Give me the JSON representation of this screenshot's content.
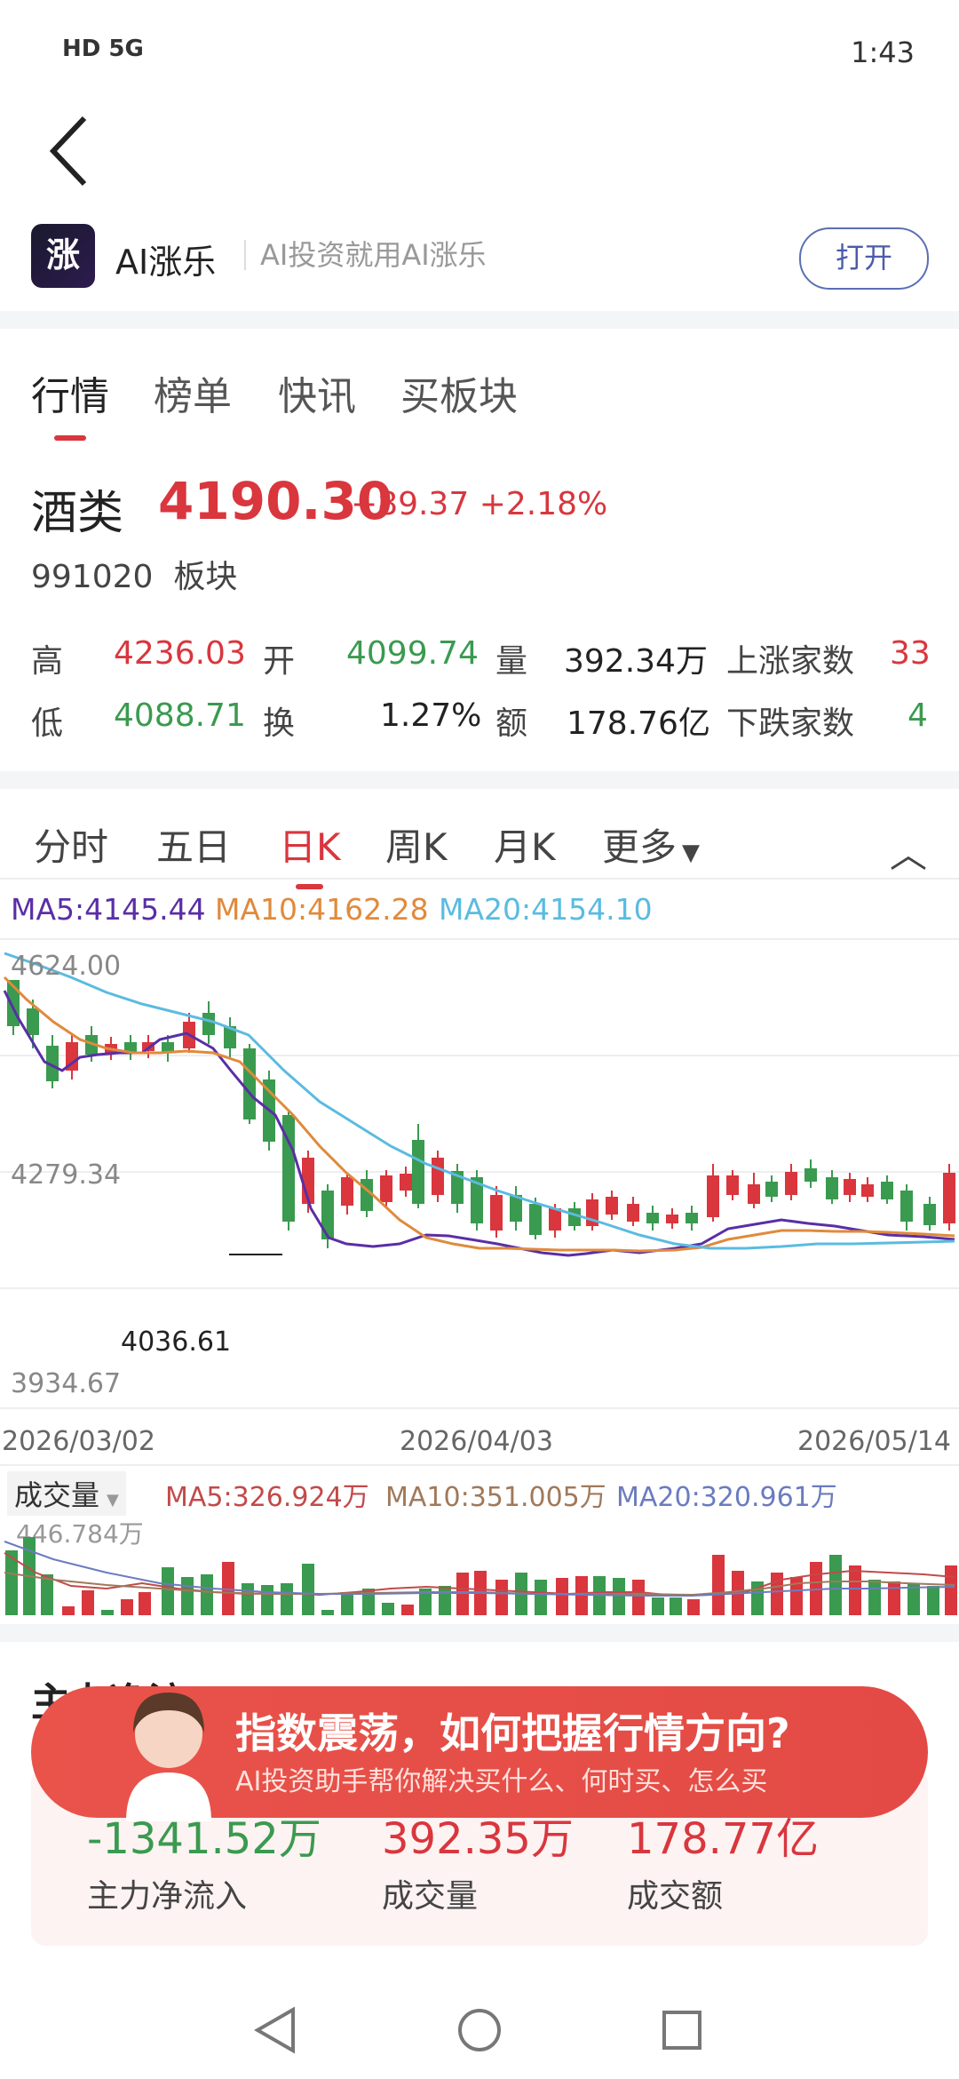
{
  "status_bar": {
    "left": "HD 5G",
    "time": "1:43"
  },
  "app": {
    "logo_text": "涨",
    "name": "AI涨乐",
    "slogan": "AI投资就用AI涨乐",
    "open_button": "打开"
  },
  "top_tabs": [
    "行情",
    "榜单",
    "快讯",
    "买板块"
  ],
  "quote": {
    "name": "酒类",
    "price": "4190.30",
    "change": "+89.37",
    "change_pct": "+2.18%",
    "code": "991020",
    "type": "板块",
    "high_label": "高",
    "high": "4236.03",
    "open_label": "开",
    "open": "4099.74",
    "volume_label": "量",
    "volume": "392.34万",
    "up_label": "上涨家数",
    "up_count": "33",
    "low_label": "低",
    "low": "4088.71",
    "turnover_label": "换",
    "turnover": "1.27%",
    "amount_label": "额",
    "amount": "178.76亿",
    "down_label": "下跌家数",
    "down_count": "4"
  },
  "chart_tabs": [
    "分时",
    "五日",
    "日K",
    "周K",
    "月K",
    "更多"
  ],
  "ma_labels": {
    "ma5": "MA5:4145.44",
    "ma10": "MA10:4162.28",
    "ma20": "MA20:4154.10"
  },
  "price_axis": {
    "high": "4624.00",
    "mid": "4279.34",
    "low": "3934.67",
    "min_marker": "4036.61"
  },
  "dates": [
    "2026/03/02",
    "2026/04/03",
    "2026/05/14"
  ],
  "volume": {
    "label": "成交量",
    "ma5": "MA5:326.924万",
    "ma10": "MA10:351.005万",
    "ma20": "MA20:320.961万",
    "max": "446.784万"
  },
  "banner": {
    "title": "指数震荡，如何把握行情方向?",
    "subtitle": "AI投资助手帮你解决买什么、何时买、怎么买"
  },
  "flow": {
    "net_inflow": "-1341.52万",
    "volume": "392.35万",
    "amount": "178.77亿",
    "net_inflow_label": "主力净流入",
    "volume_label": "成交量",
    "amount_label": "成交额",
    "section_title": "主力净流"
  },
  "colors": {
    "up": "#d9363e",
    "down": "#3a9a50",
    "ma5": "#5a2ea6",
    "ma10": "#e08a3c",
    "ma20": "#5bbbe0"
  }
}
